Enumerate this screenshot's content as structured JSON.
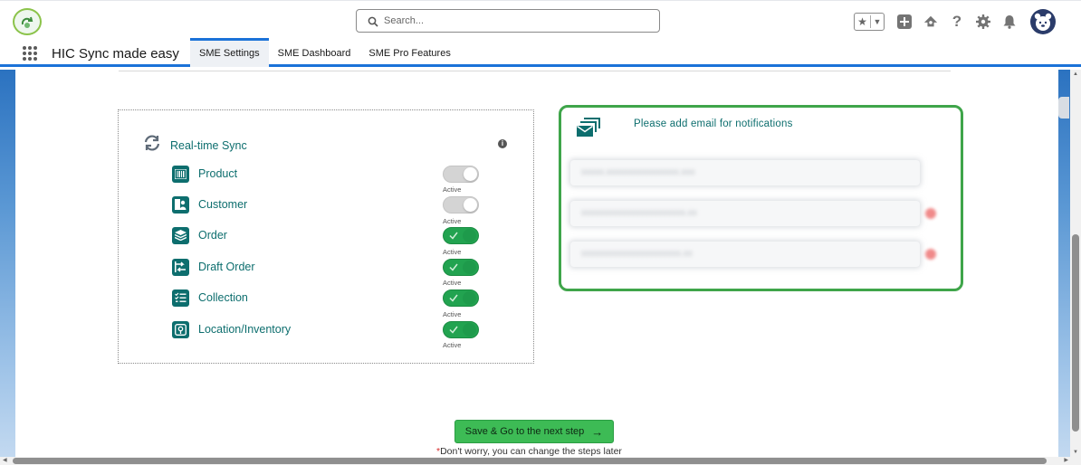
{
  "header": {
    "search_placeholder": "Search...",
    "icons": [
      "favorites-star-icon",
      "add-icon",
      "trailhead-icon",
      "help-icon",
      "setup-gear-icon",
      "notifications-bell-icon",
      "user-avatar"
    ]
  },
  "nav": {
    "app_name": "HIC Sync made easy",
    "tabs": [
      {
        "label": "SME Settings",
        "active": true
      },
      {
        "label": "SME Dashboard",
        "active": false
      },
      {
        "label": "SME Pro Features",
        "active": false
      }
    ]
  },
  "sync": {
    "title": "Real-time Sync",
    "items": [
      {
        "label": "Product",
        "icon": "barcode-icon",
        "enabled": false,
        "status": "Active"
      },
      {
        "label": "Customer",
        "icon": "contact-card-icon",
        "enabled": false,
        "status": "Active"
      },
      {
        "label": "Order",
        "icon": "layers-icon",
        "enabled": true,
        "status": "Active"
      },
      {
        "label": "Draft Order",
        "icon": "draft-order-icon",
        "enabled": true,
        "status": "Active"
      },
      {
        "label": "Collection",
        "icon": "checklist-icon",
        "enabled": true,
        "status": "Active"
      },
      {
        "label": "Location/Inventory",
        "icon": "location-icon",
        "enabled": true,
        "status": "Active"
      }
    ]
  },
  "email": {
    "title": "Please add email for notifications"
  },
  "footer": {
    "next_button": "Save & Go to the next step",
    "note_star": "*",
    "note": "Don't worry, you can change the steps later"
  },
  "colors": {
    "accent_teal": "#0d6e6e",
    "toggle_on": "#22a350",
    "brand_blue": "#1b72d8",
    "email_border": "#3fa54a"
  }
}
